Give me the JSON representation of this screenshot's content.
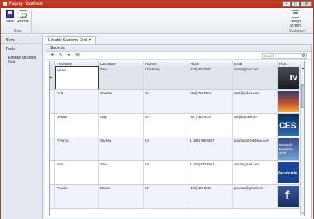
{
  "window": {
    "title": "Paging - localhost",
    "minimize": "–",
    "maximize": "□",
    "close": "✕"
  },
  "ribbon": {
    "save_label": "Save",
    "refresh_label": "Refresh",
    "data_group": "Data",
    "design_label_1": "Design",
    "design_label_2": "Screen",
    "customize_group": "Customize"
  },
  "nav": {
    "menu_label": "Menu",
    "collapse_glyph": "«",
    "tasks_label": "Tasks",
    "items": [
      {
        "label": "Editable Students Grid"
      }
    ]
  },
  "tab": {
    "label": "Editable Students Grid",
    "close_glyph": "✕"
  },
  "panel": {
    "title": "Students"
  },
  "toolbar": {
    "add_glyph": "✚",
    "edit_glyph": "✎",
    "delete_glyph": "✕",
    "export_glyph": "⊞"
  },
  "search": {
    "placeholder": "Search"
  },
  "grid": {
    "columns": [
      "First Name",
      "Last Name",
      "Address",
      "Phone",
      "Email",
      "Photo"
    ],
    "rows": [
      {
        "first": "Vineet",
        "last": "Saini",
        "address": "Uttrakhand",
        "phone": "(123) 456-7893",
        "email": "saini@gmail.com",
        "photo": "apple-tv",
        "photo_text": "tv"
      },
      {
        "first": "Amit",
        "last": "Sharma",
        "address": "UK",
        "phone": "(458) 756-5874",
        "email": "amit@yahoo.com",
        "photo": "game-screen",
        "photo_text": ""
      },
      {
        "first": "Deepak",
        "last": "Dwij",
        "address": "UP",
        "phone": "(557) 412-5478",
        "email": "dwij@gmail.com",
        "photo": "ces-logo",
        "photo_text": "CES"
      },
      {
        "first": "Priyanka",
        "last": "Sachan",
        "address": "US",
        "phone": "1 (234) 789-6587",
        "email": "psachan@rediffmail.com",
        "photo": "microsoft-dynamics",
        "photo_text": "Microsoft Dynamics CRM"
      },
      {
        "first": "Anita",
        "last": "Saini",
        "address": "UK",
        "phone": "2 (415) 874-5963",
        "email": "anita@gmail.com",
        "photo": "facebook",
        "photo_text": "facebook"
      },
      {
        "first": "Poonam",
        "last": "Bansal",
        "address": "UP",
        "phone": "(123) 478-3698",
        "email": "poonam@gmail.com",
        "photo": "facebook-f",
        "photo_text": "f"
      }
    ]
  },
  "scrollbar": {
    "up_glyph": "▲",
    "down_glyph": "▼"
  },
  "colors": {
    "accent": "#c0392b",
    "ribbon": "#e6ebf2",
    "nav": "#e4e9f1"
  }
}
